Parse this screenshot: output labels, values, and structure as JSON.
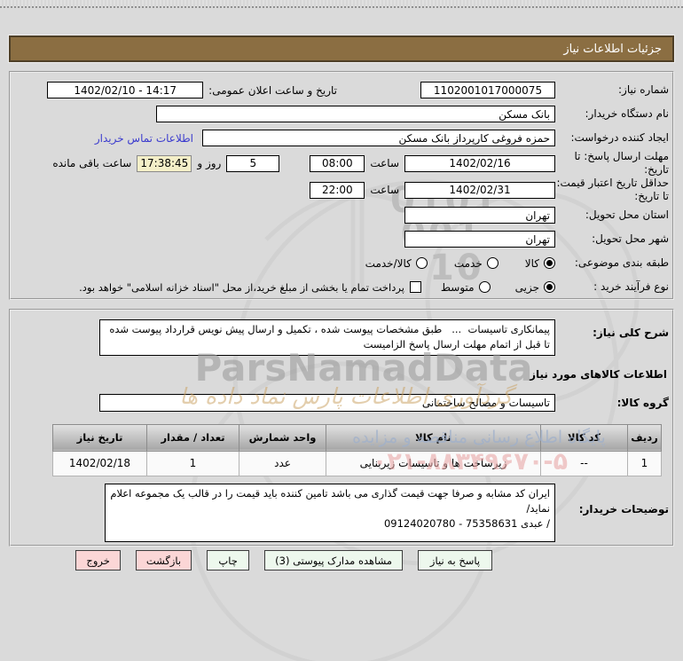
{
  "header": {
    "title": "جزئیات اطلاعات نیاز"
  },
  "form": {
    "need_number": {
      "label": "شماره نیاز:",
      "value": "1102001017000075"
    },
    "announce_datetime": {
      "label": "تاریخ و ساعت اعلان عمومی:",
      "value": "1402/02/10 - 14:17"
    },
    "buyer_org": {
      "label": "نام دستگاه خریدار:",
      "value": "بانک مسکن"
    },
    "request_creator": {
      "label": "ایجاد کننده درخواست:",
      "value": "حمزه فروغی کارپرداز بانک مسکن",
      "contact_link": "اطلاعات تماس خریدار"
    },
    "reply_deadline": {
      "label": "مهلت ارسال پاسخ: تا تاریخ:",
      "date": "1402/02/16",
      "hour_label": "ساعت",
      "hour": "08:00",
      "days": "5",
      "days_label": "روز و",
      "remaining": "17:38:45",
      "remaining_label": "ساعت باقی مانده"
    },
    "price_validity": {
      "label": "حداقل تاریخ اعتبار قیمت: تا تاریخ:",
      "date": "1402/02/31",
      "hour_label": "ساعت",
      "hour": "22:00"
    },
    "province": {
      "label": "استان محل تحویل:",
      "value": "تهران"
    },
    "city": {
      "label": "شهر محل تحویل:",
      "value": "تهران"
    },
    "classification": {
      "label": "طبقه بندی موضوعی:",
      "options": [
        "کالا",
        "خدمت",
        "کالا/خدمت"
      ],
      "selected": "کالا"
    },
    "process_type": {
      "label": "نوع فرآیند خرید :",
      "options": [
        "جزیی",
        "متوسط"
      ],
      "selected": "جزیی",
      "checkbox_label": "پرداخت تمام یا بخشی از مبلغ خرید،از محل \"اسناد خزانه اسلامی\" خواهد بود.",
      "checkbox_checked": false
    }
  },
  "need_section": {
    "desc_label": "شرح کلی نیاز:",
    "desc_value": "پیمانکاری تاسیسات  ...   طبق مشخصات پیوست شده ، تکمیل و ارسال پیش نویس قرارداد پیوست شده تا قبل از اتمام مهلت ارسال پاسخ الزامیست",
    "goods_heading": "اطلاعات کالاهای مورد نیاز",
    "group_label": "گروه کالا:",
    "group_value": "تاسیسات و مصالح ساختمانی",
    "table": {
      "headers": [
        "ردیف",
        "کد کالا",
        "نام کالا",
        "واحد شمارش",
        "تعداد / مقدار",
        "تاریخ نیاز"
      ],
      "rows": [
        [
          "1",
          "--",
          "زیرساخت ها و تاسیسات زیربنایی",
          "عدد",
          "1",
          "1402/02/18"
        ]
      ]
    },
    "buyer_notes_label": "توضیحات خریدار:",
    "buyer_notes_value": "ایران کد مشابه و صرفا جهت قیمت گذاری می باشد تامین کننده باید قیمت را در قالب یک مجموعه اعلام نماید/\n/ عبدی 75358631 - 09124020780"
  },
  "buttons": [
    {
      "label": "پاسخ به نیاز",
      "style": "green"
    },
    {
      "label": "مشاهده مدارک پیوستی (3)",
      "style": "green"
    },
    {
      "label": "چاپ",
      "style": "green"
    },
    {
      "label": "بازگشت",
      "style": "pink"
    },
    {
      "label": "خروج",
      "style": "pink"
    }
  ],
  "watermark": {
    "brand": "ParsNamadData",
    "digits": [
      "0101",
      "001",
      "10"
    ],
    "tan_text": "گردآوری اطلاعات پارس نماد داده ها",
    "blue_text": "پایگاه اطلاع رسانی مناقصه و مزایده",
    "phone": "۰۲۱-۸۸۳۴۹۶۷۰-۵"
  },
  "colors": {
    "title_bar": "#8b6e42",
    "button_green": "#edf8ed",
    "button_pink": "#fbd6d6",
    "timer_bg": "#f4efc8",
    "link": "#3b3bce"
  }
}
